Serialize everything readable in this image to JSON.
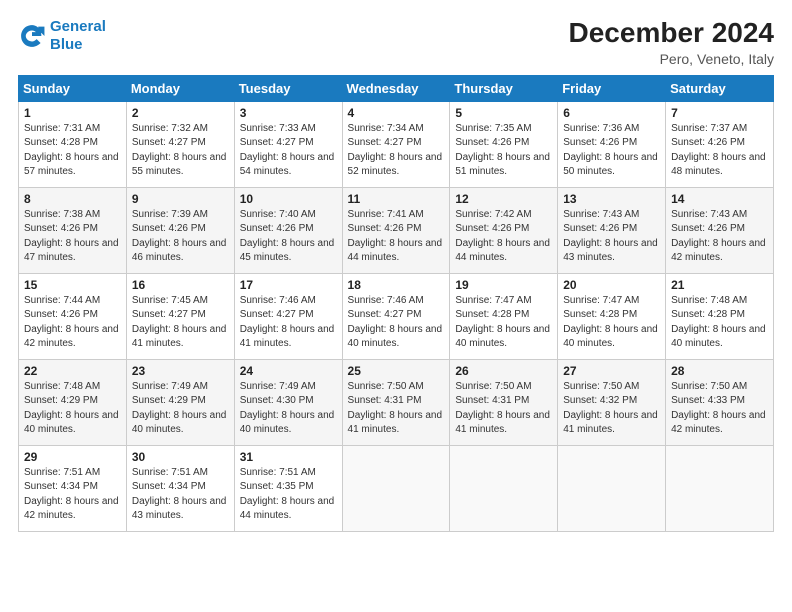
{
  "logo": {
    "line1": "General",
    "line2": "Blue"
  },
  "title": "December 2024",
  "subtitle": "Pero, Veneto, Italy",
  "weekdays": [
    "Sunday",
    "Monday",
    "Tuesday",
    "Wednesday",
    "Thursday",
    "Friday",
    "Saturday"
  ],
  "weeks": [
    [
      {
        "day": "1",
        "sunrise": "Sunrise: 7:31 AM",
        "sunset": "Sunset: 4:28 PM",
        "daylight": "Daylight: 8 hours and 57 minutes."
      },
      {
        "day": "2",
        "sunrise": "Sunrise: 7:32 AM",
        "sunset": "Sunset: 4:27 PM",
        "daylight": "Daylight: 8 hours and 55 minutes."
      },
      {
        "day": "3",
        "sunrise": "Sunrise: 7:33 AM",
        "sunset": "Sunset: 4:27 PM",
        "daylight": "Daylight: 8 hours and 54 minutes."
      },
      {
        "day": "4",
        "sunrise": "Sunrise: 7:34 AM",
        "sunset": "Sunset: 4:27 PM",
        "daylight": "Daylight: 8 hours and 52 minutes."
      },
      {
        "day": "5",
        "sunrise": "Sunrise: 7:35 AM",
        "sunset": "Sunset: 4:26 PM",
        "daylight": "Daylight: 8 hours and 51 minutes."
      },
      {
        "day": "6",
        "sunrise": "Sunrise: 7:36 AM",
        "sunset": "Sunset: 4:26 PM",
        "daylight": "Daylight: 8 hours and 50 minutes."
      },
      {
        "day": "7",
        "sunrise": "Sunrise: 7:37 AM",
        "sunset": "Sunset: 4:26 PM",
        "daylight": "Daylight: 8 hours and 48 minutes."
      }
    ],
    [
      {
        "day": "8",
        "sunrise": "Sunrise: 7:38 AM",
        "sunset": "Sunset: 4:26 PM",
        "daylight": "Daylight: 8 hours and 47 minutes."
      },
      {
        "day": "9",
        "sunrise": "Sunrise: 7:39 AM",
        "sunset": "Sunset: 4:26 PM",
        "daylight": "Daylight: 8 hours and 46 minutes."
      },
      {
        "day": "10",
        "sunrise": "Sunrise: 7:40 AM",
        "sunset": "Sunset: 4:26 PM",
        "daylight": "Daylight: 8 hours and 45 minutes."
      },
      {
        "day": "11",
        "sunrise": "Sunrise: 7:41 AM",
        "sunset": "Sunset: 4:26 PM",
        "daylight": "Daylight: 8 hours and 44 minutes."
      },
      {
        "day": "12",
        "sunrise": "Sunrise: 7:42 AM",
        "sunset": "Sunset: 4:26 PM",
        "daylight": "Daylight: 8 hours and 44 minutes."
      },
      {
        "day": "13",
        "sunrise": "Sunrise: 7:43 AM",
        "sunset": "Sunset: 4:26 PM",
        "daylight": "Daylight: 8 hours and 43 minutes."
      },
      {
        "day": "14",
        "sunrise": "Sunrise: 7:43 AM",
        "sunset": "Sunset: 4:26 PM",
        "daylight": "Daylight: 8 hours and 42 minutes."
      }
    ],
    [
      {
        "day": "15",
        "sunrise": "Sunrise: 7:44 AM",
        "sunset": "Sunset: 4:26 PM",
        "daylight": "Daylight: 8 hours and 42 minutes."
      },
      {
        "day": "16",
        "sunrise": "Sunrise: 7:45 AM",
        "sunset": "Sunset: 4:27 PM",
        "daylight": "Daylight: 8 hours and 41 minutes."
      },
      {
        "day": "17",
        "sunrise": "Sunrise: 7:46 AM",
        "sunset": "Sunset: 4:27 PM",
        "daylight": "Daylight: 8 hours and 41 minutes."
      },
      {
        "day": "18",
        "sunrise": "Sunrise: 7:46 AM",
        "sunset": "Sunset: 4:27 PM",
        "daylight": "Daylight: 8 hours and 40 minutes."
      },
      {
        "day": "19",
        "sunrise": "Sunrise: 7:47 AM",
        "sunset": "Sunset: 4:28 PM",
        "daylight": "Daylight: 8 hours and 40 minutes."
      },
      {
        "day": "20",
        "sunrise": "Sunrise: 7:47 AM",
        "sunset": "Sunset: 4:28 PM",
        "daylight": "Daylight: 8 hours and 40 minutes."
      },
      {
        "day": "21",
        "sunrise": "Sunrise: 7:48 AM",
        "sunset": "Sunset: 4:28 PM",
        "daylight": "Daylight: 8 hours and 40 minutes."
      }
    ],
    [
      {
        "day": "22",
        "sunrise": "Sunrise: 7:48 AM",
        "sunset": "Sunset: 4:29 PM",
        "daylight": "Daylight: 8 hours and 40 minutes."
      },
      {
        "day": "23",
        "sunrise": "Sunrise: 7:49 AM",
        "sunset": "Sunset: 4:29 PM",
        "daylight": "Daylight: 8 hours and 40 minutes."
      },
      {
        "day": "24",
        "sunrise": "Sunrise: 7:49 AM",
        "sunset": "Sunset: 4:30 PM",
        "daylight": "Daylight: 8 hours and 40 minutes."
      },
      {
        "day": "25",
        "sunrise": "Sunrise: 7:50 AM",
        "sunset": "Sunset: 4:31 PM",
        "daylight": "Daylight: 8 hours and 41 minutes."
      },
      {
        "day": "26",
        "sunrise": "Sunrise: 7:50 AM",
        "sunset": "Sunset: 4:31 PM",
        "daylight": "Daylight: 8 hours and 41 minutes."
      },
      {
        "day": "27",
        "sunrise": "Sunrise: 7:50 AM",
        "sunset": "Sunset: 4:32 PM",
        "daylight": "Daylight: 8 hours and 41 minutes."
      },
      {
        "day": "28",
        "sunrise": "Sunrise: 7:50 AM",
        "sunset": "Sunset: 4:33 PM",
        "daylight": "Daylight: 8 hours and 42 minutes."
      }
    ],
    [
      {
        "day": "29",
        "sunrise": "Sunrise: 7:51 AM",
        "sunset": "Sunset: 4:34 PM",
        "daylight": "Daylight: 8 hours and 42 minutes."
      },
      {
        "day": "30",
        "sunrise": "Sunrise: 7:51 AM",
        "sunset": "Sunset: 4:34 PM",
        "daylight": "Daylight: 8 hours and 43 minutes."
      },
      {
        "day": "31",
        "sunrise": "Sunrise: 7:51 AM",
        "sunset": "Sunset: 4:35 PM",
        "daylight": "Daylight: 8 hours and 44 minutes."
      },
      null,
      null,
      null,
      null
    ]
  ]
}
